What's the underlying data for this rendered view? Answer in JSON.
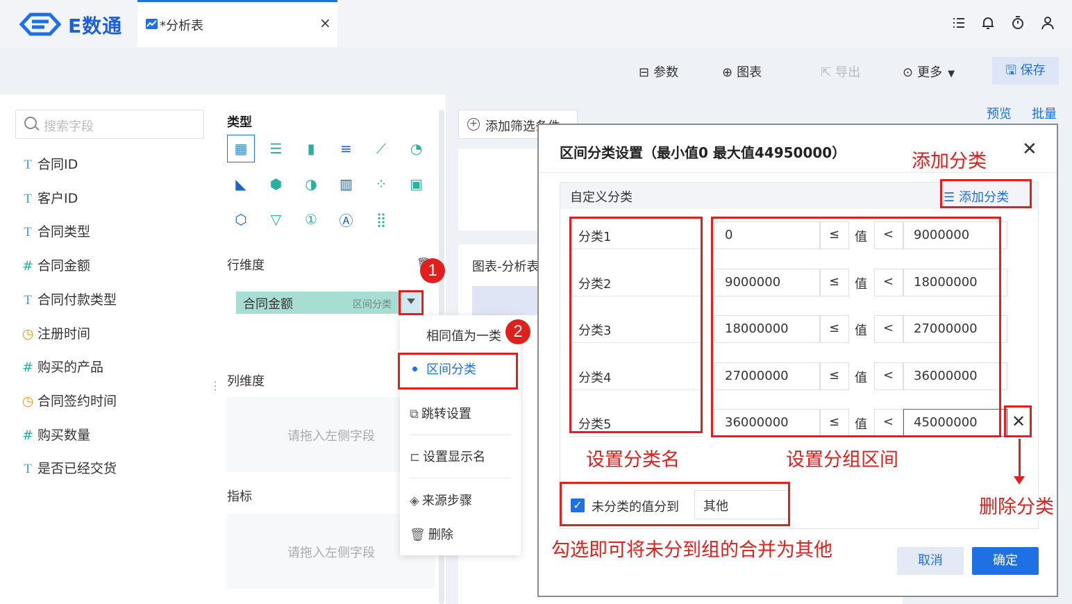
{
  "app": {
    "name": "E数通"
  },
  "tab": {
    "label": "*分析表"
  },
  "toolbar": {
    "params": "参数",
    "chart": "图表",
    "export": "导出",
    "more": "更多",
    "save": "保存"
  },
  "search": {
    "placeholder": "搜索字段"
  },
  "fields": [
    {
      "icon": "T",
      "label": "合同ID",
      "kind": "text"
    },
    {
      "icon": "T",
      "label": "客户ID",
      "kind": "text"
    },
    {
      "icon": "T",
      "label": "合同类型",
      "kind": "text"
    },
    {
      "icon": "#",
      "label": "合同金额",
      "kind": "number"
    },
    {
      "icon": "T",
      "label": "合同付款类型",
      "kind": "text"
    },
    {
      "icon": "◷",
      "label": "注册时间",
      "kind": "date"
    },
    {
      "icon": "#",
      "label": "购买的产品",
      "kind": "number"
    },
    {
      "icon": "◷",
      "label": "合同签约时间",
      "kind": "date"
    },
    {
      "icon": "#",
      "label": "购买数量",
      "kind": "number"
    },
    {
      "icon": "T",
      "label": "是否已经交货",
      "kind": "text"
    }
  ],
  "config": {
    "type_label": "类型",
    "row_dim": "行维度",
    "col_dim": "列维度",
    "metric": "指标",
    "drop_hint": "请拖入左侧字段",
    "chip_label": "合同金额",
    "chip_tag": "区间分类"
  },
  "menu": {
    "items": [
      "相同值为一类",
      "区间分类",
      "跳转设置",
      "设置显示名",
      "来源步骤",
      "删除"
    ]
  },
  "chart_area": {
    "filter": "添加筛选条件",
    "card_title": "图表-分析表",
    "preview": "预览",
    "batch": "批量"
  },
  "dialog": {
    "title": "区间分类设置（最小值0 最大值44950000）",
    "section": "自定义分类",
    "add": "添加分类",
    "rows": [
      {
        "name": "分类1",
        "min": "0",
        "op1": "≤",
        "mid": "值",
        "op2": "<",
        "max": "9000000"
      },
      {
        "name": "分类2",
        "min": "9000000",
        "op1": "≤",
        "mid": "值",
        "op2": "<",
        "max": "18000000"
      },
      {
        "name": "分类3",
        "min": "18000000",
        "op1": "≤",
        "mid": "值",
        "op2": "<",
        "max": "27000000"
      },
      {
        "name": "分类4",
        "min": "27000000",
        "op1": "≤",
        "mid": "值",
        "op2": "<",
        "max": "36000000"
      },
      {
        "name": "分类5",
        "min": "36000000",
        "op1": "≤",
        "mid": "值",
        "op2": "<",
        "max": "45000000"
      }
    ],
    "unclassified_label": "未分类的值分到",
    "unclassified_value": "其他",
    "cancel": "取消",
    "ok": "确定"
  },
  "annotations": {
    "badge1": "1",
    "badge2": "2",
    "add_category": "添加分类",
    "set_name": "设置分类名",
    "set_range": "设置分组区间",
    "delete": "删除分类",
    "check_hint": "勾选即可将未分到组的合并为其他"
  },
  "colors": {
    "accent": "#1f6fe5",
    "annotation": "#e0201c",
    "chip": "#a7ddd3"
  }
}
